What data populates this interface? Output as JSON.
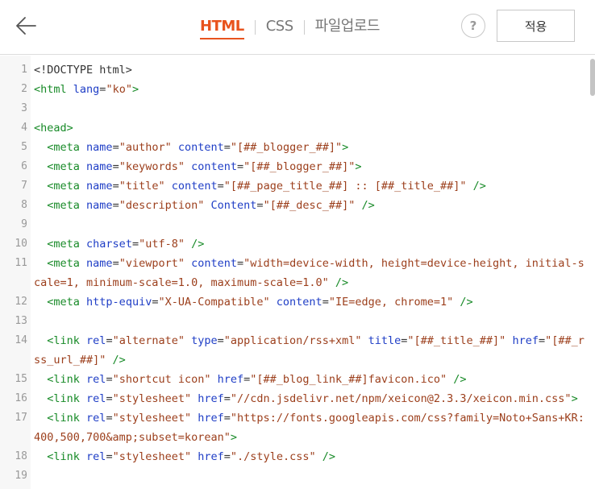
{
  "header": {
    "back_icon": "arrow-left-icon",
    "tabs": [
      {
        "label": "HTML",
        "active": true
      },
      {
        "label": "CSS",
        "active": false
      },
      {
        "label": "파일업로드",
        "active": false
      }
    ],
    "help_label": "?",
    "apply_label": "적용"
  },
  "colors": {
    "accent": "#e8531d",
    "tag": "#178a27",
    "attribute": "#1f3ec6",
    "string": "#9c3f1c",
    "plain": "#333333",
    "line_number": "#999999"
  },
  "editor": {
    "lines": [
      {
        "num": "1",
        "tokens": [
          [
            "plain",
            "<!DOCTYPE html>"
          ]
        ]
      },
      {
        "num": "2",
        "tokens": [
          [
            "tag",
            "<html"
          ],
          [
            "plain",
            " "
          ],
          [
            "attr",
            "lang"
          ],
          [
            "plain",
            "="
          ],
          [
            "str",
            "\"ko\""
          ],
          [
            "tag",
            ">"
          ]
        ]
      },
      {
        "num": "3",
        "tokens": []
      },
      {
        "num": "4",
        "tokens": [
          [
            "tag",
            "<head>"
          ]
        ]
      },
      {
        "num": "5",
        "tokens": [
          [
            "plain",
            "  "
          ],
          [
            "tag",
            "<meta"
          ],
          [
            "plain",
            " "
          ],
          [
            "attr",
            "name"
          ],
          [
            "plain",
            "="
          ],
          [
            "str",
            "\"author\""
          ],
          [
            "plain",
            " "
          ],
          [
            "attr",
            "content"
          ],
          [
            "plain",
            "="
          ],
          [
            "str",
            "\"[##_blogger_##]\""
          ],
          [
            "tag",
            ">"
          ]
        ]
      },
      {
        "num": "6",
        "tokens": [
          [
            "plain",
            "  "
          ],
          [
            "tag",
            "<meta"
          ],
          [
            "plain",
            " "
          ],
          [
            "attr",
            "name"
          ],
          [
            "plain",
            "="
          ],
          [
            "str",
            "\"keywords\""
          ],
          [
            "plain",
            " "
          ],
          [
            "attr",
            "content"
          ],
          [
            "plain",
            "="
          ],
          [
            "str",
            "\"[##_blogger_##]\""
          ],
          [
            "tag",
            ">"
          ]
        ]
      },
      {
        "num": "7",
        "tokens": [
          [
            "plain",
            "  "
          ],
          [
            "tag",
            "<meta"
          ],
          [
            "plain",
            " "
          ],
          [
            "attr",
            "name"
          ],
          [
            "plain",
            "="
          ],
          [
            "str",
            "\"title\""
          ],
          [
            "plain",
            " "
          ],
          [
            "attr",
            "content"
          ],
          [
            "plain",
            "="
          ],
          [
            "str",
            "\"[##_page_title_##] :: [##_title_##]\""
          ],
          [
            "plain",
            " "
          ],
          [
            "tag",
            "/>"
          ]
        ]
      },
      {
        "num": "8",
        "tokens": [
          [
            "plain",
            "  "
          ],
          [
            "tag",
            "<meta"
          ],
          [
            "plain",
            " "
          ],
          [
            "attr",
            "name"
          ],
          [
            "plain",
            "="
          ],
          [
            "str",
            "\"description\""
          ],
          [
            "plain",
            " "
          ],
          [
            "attr",
            "Content"
          ],
          [
            "plain",
            "="
          ],
          [
            "str",
            "\"[##_desc_##]\""
          ],
          [
            "plain",
            " "
          ],
          [
            "tag",
            "/>"
          ]
        ]
      },
      {
        "num": "9",
        "tokens": []
      },
      {
        "num": "10",
        "tokens": [
          [
            "plain",
            "  "
          ],
          [
            "tag",
            "<meta"
          ],
          [
            "plain",
            " "
          ],
          [
            "attr",
            "charset"
          ],
          [
            "plain",
            "="
          ],
          [
            "str",
            "\"utf-8\""
          ],
          [
            "plain",
            " "
          ],
          [
            "tag",
            "/>"
          ]
        ]
      },
      {
        "num": "11",
        "tokens": [
          [
            "plain",
            "  "
          ],
          [
            "tag",
            "<meta"
          ],
          [
            "plain",
            " "
          ],
          [
            "attr",
            "name"
          ],
          [
            "plain",
            "="
          ],
          [
            "str",
            "\"viewport\""
          ],
          [
            "plain",
            " "
          ],
          [
            "attr",
            "content"
          ],
          [
            "plain",
            "="
          ],
          [
            "str",
            "\"width=device-width, height=device-height, initial-scale=1, minimum-scale=1.0, maximum-scale=1.0\""
          ],
          [
            "plain",
            " "
          ],
          [
            "tag",
            "/>"
          ]
        ]
      },
      {
        "num": "12",
        "tokens": [
          [
            "plain",
            "  "
          ],
          [
            "tag",
            "<meta"
          ],
          [
            "plain",
            " "
          ],
          [
            "attr",
            "http-equiv"
          ],
          [
            "plain",
            "="
          ],
          [
            "str",
            "\"X-UA-Compatible\""
          ],
          [
            "plain",
            " "
          ],
          [
            "attr",
            "content"
          ],
          [
            "plain",
            "="
          ],
          [
            "str",
            "\"IE=edge, chrome=1\""
          ],
          [
            "plain",
            " "
          ],
          [
            "tag",
            "/>"
          ]
        ]
      },
      {
        "num": "13",
        "tokens": []
      },
      {
        "num": "14",
        "tokens": [
          [
            "plain",
            "  "
          ],
          [
            "tag",
            "<link"
          ],
          [
            "plain",
            " "
          ],
          [
            "attr",
            "rel"
          ],
          [
            "plain",
            "="
          ],
          [
            "str",
            "\"alternate\""
          ],
          [
            "plain",
            " "
          ],
          [
            "attr",
            "type"
          ],
          [
            "plain",
            "="
          ],
          [
            "str",
            "\"application/rss+xml\""
          ],
          [
            "plain",
            " "
          ],
          [
            "attr",
            "title"
          ],
          [
            "plain",
            "="
          ],
          [
            "str",
            "\"[##_title_##]\""
          ],
          [
            "plain",
            " "
          ],
          [
            "attr",
            "href"
          ],
          [
            "plain",
            "="
          ],
          [
            "str",
            "\"[##_rss_url_##]\""
          ],
          [
            "plain",
            " "
          ],
          [
            "tag",
            "/>"
          ]
        ]
      },
      {
        "num": "15",
        "tokens": [
          [
            "plain",
            "  "
          ],
          [
            "tag",
            "<link"
          ],
          [
            "plain",
            " "
          ],
          [
            "attr",
            "rel"
          ],
          [
            "plain",
            "="
          ],
          [
            "str",
            "\"shortcut icon\""
          ],
          [
            "plain",
            " "
          ],
          [
            "attr",
            "href"
          ],
          [
            "plain",
            "="
          ],
          [
            "str",
            "\"[##_blog_link_##]favicon.ico\""
          ],
          [
            "plain",
            " "
          ],
          [
            "tag",
            "/>"
          ]
        ]
      },
      {
        "num": "16",
        "tokens": [
          [
            "plain",
            "  "
          ],
          [
            "tag",
            "<link"
          ],
          [
            "plain",
            " "
          ],
          [
            "attr",
            "rel"
          ],
          [
            "plain",
            "="
          ],
          [
            "str",
            "\"stylesheet\""
          ],
          [
            "plain",
            " "
          ],
          [
            "attr",
            "href"
          ],
          [
            "plain",
            "="
          ],
          [
            "str",
            "\"//cdn.jsdelivr.net/npm/xeicon@2.3.3/xeicon.min.css\""
          ],
          [
            "tag",
            ">"
          ]
        ]
      },
      {
        "num": "17",
        "tokens": [
          [
            "plain",
            "  "
          ],
          [
            "tag",
            "<link"
          ],
          [
            "plain",
            " "
          ],
          [
            "attr",
            "rel"
          ],
          [
            "plain",
            "="
          ],
          [
            "str",
            "\"stylesheet\""
          ],
          [
            "plain",
            " "
          ],
          [
            "attr",
            "href"
          ],
          [
            "plain",
            "="
          ],
          [
            "str",
            "\"https://fonts.googleapis.com/css?family=Noto+Sans+KR:400,500,700&amp;subset=korean\""
          ],
          [
            "tag",
            ">"
          ]
        ]
      },
      {
        "num": "18",
        "tokens": [
          [
            "plain",
            "  "
          ],
          [
            "tag",
            "<link"
          ],
          [
            "plain",
            " "
          ],
          [
            "attr",
            "rel"
          ],
          [
            "plain",
            "="
          ],
          [
            "str",
            "\"stylesheet\""
          ],
          [
            "plain",
            " "
          ],
          [
            "attr",
            "href"
          ],
          [
            "plain",
            "="
          ],
          [
            "str",
            "\"./style.css\""
          ],
          [
            "plain",
            " "
          ],
          [
            "tag",
            "/>"
          ]
        ]
      },
      {
        "num": "19",
        "tokens": []
      }
    ]
  }
}
